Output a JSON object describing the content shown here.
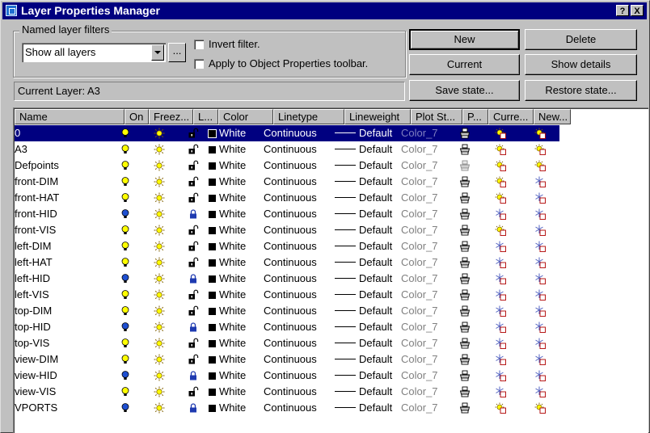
{
  "window": {
    "title": "Layer Properties Manager",
    "help_glyph": "?",
    "close_glyph": "X"
  },
  "filters": {
    "group_label": "Named layer filters",
    "selected": "Show all layers",
    "ellipsis_label": "...",
    "invert_label": "Invert filter.",
    "apply_label": "Apply to Object Properties toolbar."
  },
  "buttons": {
    "new": "New",
    "delete": "Delete",
    "current": "Current",
    "show_details": "Show details",
    "save_state": "Save state...",
    "restore_state": "Restore state..."
  },
  "current_layer": "Current Layer:  A3",
  "columns": [
    "Name",
    "On",
    "Freez...",
    "L...",
    "Color",
    "Linetype",
    "Lineweight",
    "Plot St...",
    "P...",
    "Curre...",
    "New..."
  ],
  "colors": {
    "title_bg": "#00007f",
    "selection": "#000080",
    "bulb_on": "#ffff00",
    "bulb_off": "#1e4fd0"
  },
  "rows": [
    {
      "name": "0",
      "on": true,
      "lock": "unlocked",
      "color": "White",
      "linetype": "Continuous",
      "lineweight": "Default",
      "plotstyle": "Color_7",
      "plot": "printer",
      "cur_vp": "sun",
      "new_vp": "sun",
      "selected": true
    },
    {
      "name": "A3",
      "on": true,
      "lock": "unlocked",
      "color": "White",
      "linetype": "Continuous",
      "lineweight": "Default",
      "plotstyle": "Color_7",
      "plot": "printer",
      "cur_vp": "sun",
      "new_vp": "sun"
    },
    {
      "name": "Defpoints",
      "on": true,
      "lock": "unlocked",
      "color": "White",
      "linetype": "Continuous",
      "lineweight": "Default",
      "plotstyle": "Color_7",
      "plot": "printer-disabled",
      "cur_vp": "sun",
      "new_vp": "sun"
    },
    {
      "name": "front-DIM",
      "on": true,
      "lock": "unlocked",
      "color": "White",
      "linetype": "Continuous",
      "lineweight": "Default",
      "plotstyle": "Color_7",
      "plot": "printer",
      "cur_vp": "sun",
      "new_vp": "snowflake"
    },
    {
      "name": "front-HAT",
      "on": true,
      "lock": "unlocked",
      "color": "White",
      "linetype": "Continuous",
      "lineweight": "Default",
      "plotstyle": "Color_7",
      "plot": "printer",
      "cur_vp": "sun",
      "new_vp": "snowflake"
    },
    {
      "name": "front-HID",
      "on": false,
      "lock": "locked",
      "color": "White",
      "linetype": "Continuous",
      "lineweight": "Default",
      "plotstyle": "Color_7",
      "plot": "printer",
      "cur_vp": "snowflake",
      "new_vp": "snowflake"
    },
    {
      "name": "front-VIS",
      "on": true,
      "lock": "unlocked",
      "color": "White",
      "linetype": "Continuous",
      "lineweight": "Default",
      "plotstyle": "Color_7",
      "plot": "printer",
      "cur_vp": "sun",
      "new_vp": "snowflake"
    },
    {
      "name": "left-DIM",
      "on": true,
      "lock": "unlocked",
      "color": "White",
      "linetype": "Continuous",
      "lineweight": "Default",
      "plotstyle": "Color_7",
      "plot": "printer",
      "cur_vp": "snowflake",
      "new_vp": "snowflake"
    },
    {
      "name": "left-HAT",
      "on": true,
      "lock": "unlocked",
      "color": "White",
      "linetype": "Continuous",
      "lineweight": "Default",
      "plotstyle": "Color_7",
      "plot": "printer",
      "cur_vp": "snowflake",
      "new_vp": "snowflake"
    },
    {
      "name": "left-HID",
      "on": false,
      "lock": "locked",
      "color": "White",
      "linetype": "Continuous",
      "lineweight": "Default",
      "plotstyle": "Color_7",
      "plot": "printer",
      "cur_vp": "snowflake",
      "new_vp": "snowflake"
    },
    {
      "name": "left-VIS",
      "on": true,
      "lock": "unlocked",
      "color": "White",
      "linetype": "Continuous",
      "lineweight": "Default",
      "plotstyle": "Color_7",
      "plot": "printer",
      "cur_vp": "snowflake",
      "new_vp": "snowflake"
    },
    {
      "name": "top-DIM",
      "on": true,
      "lock": "unlocked",
      "color": "White",
      "linetype": "Continuous",
      "lineweight": "Default",
      "plotstyle": "Color_7",
      "plot": "printer",
      "cur_vp": "snowflake",
      "new_vp": "snowflake"
    },
    {
      "name": "top-HID",
      "on": false,
      "lock": "locked",
      "color": "White",
      "linetype": "Continuous",
      "lineweight": "Default",
      "plotstyle": "Color_7",
      "plot": "printer",
      "cur_vp": "snowflake",
      "new_vp": "snowflake"
    },
    {
      "name": "top-VIS",
      "on": true,
      "lock": "unlocked",
      "color": "White",
      "linetype": "Continuous",
      "lineweight": "Default",
      "plotstyle": "Color_7",
      "plot": "printer",
      "cur_vp": "snowflake",
      "new_vp": "snowflake"
    },
    {
      "name": "view-DIM",
      "on": true,
      "lock": "unlocked",
      "color": "White",
      "linetype": "Continuous",
      "lineweight": "Default",
      "plotstyle": "Color_7",
      "plot": "printer",
      "cur_vp": "snowflake",
      "new_vp": "snowflake"
    },
    {
      "name": "view-HID",
      "on": false,
      "lock": "locked",
      "color": "White",
      "linetype": "Continuous",
      "lineweight": "Default",
      "plotstyle": "Color_7",
      "plot": "printer",
      "cur_vp": "snowflake",
      "new_vp": "snowflake"
    },
    {
      "name": "view-VIS",
      "on": true,
      "lock": "unlocked",
      "color": "White",
      "linetype": "Continuous",
      "lineweight": "Default",
      "plotstyle": "Color_7",
      "plot": "printer",
      "cur_vp": "snowflake",
      "new_vp": "snowflake"
    },
    {
      "name": "VPORTS",
      "on": false,
      "lock": "locked",
      "color": "White",
      "linetype": "Continuous",
      "lineweight": "Default",
      "plotstyle": "Color_7",
      "plot": "printer",
      "cur_vp": "sun",
      "new_vp": "sun"
    }
  ]
}
